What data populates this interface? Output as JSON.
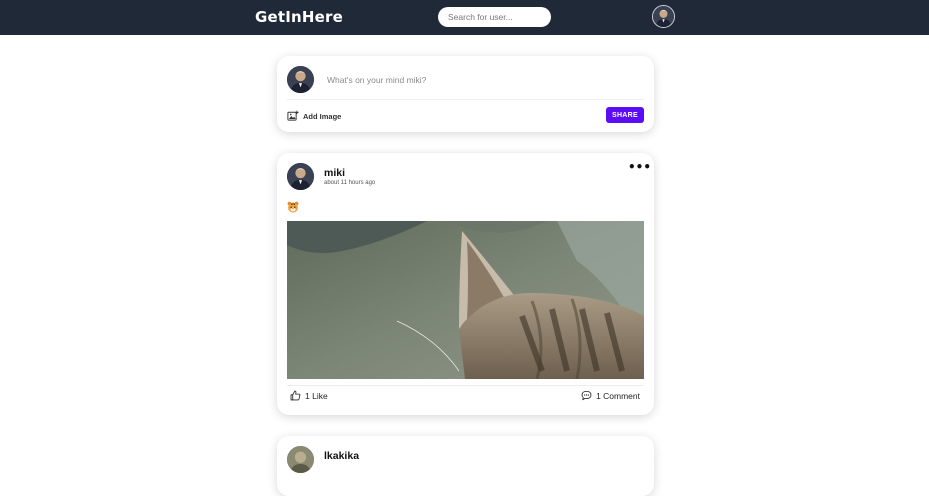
{
  "navbar": {
    "brand": "GetInHere",
    "search_placeholder": "Search for user...",
    "avatar_icon": "user-avatar-icon"
  },
  "composer": {
    "placeholder": "What's on your mind miki?",
    "add_image_label": "Add Image",
    "add_image_icon": "image-add-icon",
    "share_label": "SHARE",
    "share_color": "#5b0ef5"
  },
  "posts": [
    {
      "username": "miki",
      "time": "about 11 hours ago",
      "more_icon": "more-horizontal-icon",
      "text_emoji": "tiger-face-emoji",
      "image": "cat-ear-photo",
      "likes_label": "1 Like",
      "like_icon": "thumbs-up-icon",
      "comments_label": "1 Comment",
      "comment_icon": "comment-icon"
    },
    {
      "username": "lkakika"
    }
  ],
  "colors": {
    "navbar_bg": "#1f2937",
    "accent": "#5b0ef5",
    "page_bg": "#ffffff"
  }
}
